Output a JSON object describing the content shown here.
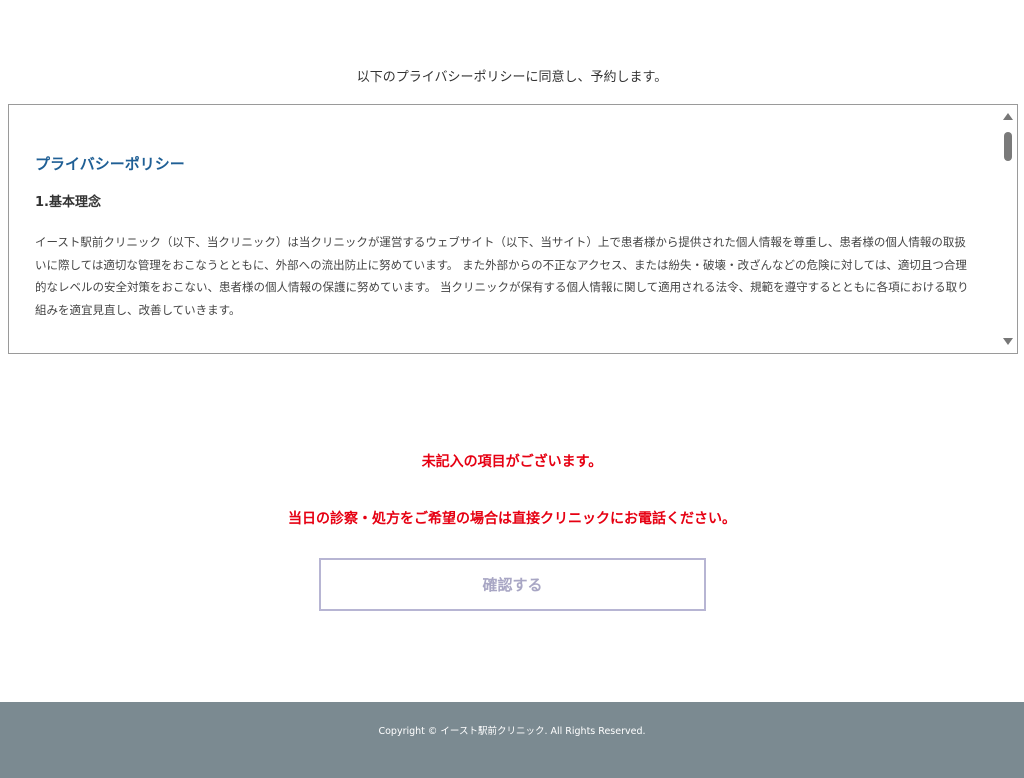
{
  "agreement": {
    "text": "以下のプライバシーポリシーに同意し、予約します。"
  },
  "policy": {
    "title": "プライバシーポリシー",
    "section_1_heading": "1.基本理念",
    "section_1_body": "イースト駅前クリニック（以下、当クリニック）は当クリニックが運営するウェブサイト（以下、当サイト）上で患者様から提供された個人情報を尊重し、患者様の個人情報の取扱いに際しては適切な管理をおこなうとともに、外部への流出防止に努めています。 また外部からの不正なアクセス、または紛失・破壊・改ざんなどの危険に対しては、適切且つ合理的なレベルの安全対策をおこない、患者様の個人情報の保護に努めています。 当クリニックが保有する個人情報に関して適用される法令、規範を遵守するとともに各項における取り組みを適宜見直し、改善していきます。"
  },
  "errors": {
    "missing_fields": "未記入の項目がございます。",
    "same_day_notice": "当日の診察・処方をご希望の場合は直接クリニックにお電話ください。"
  },
  "confirm": {
    "label": "確認する"
  },
  "footer": {
    "copyright": "Copyright © イースト駅前クリニック. All Rights Reserved."
  },
  "colors": {
    "policy_title": "#1f5f95",
    "error": "#e60012",
    "button_border": "#b7b5d3",
    "button_text": "#a8a6c4",
    "footer_bg": "#7b8a91"
  }
}
